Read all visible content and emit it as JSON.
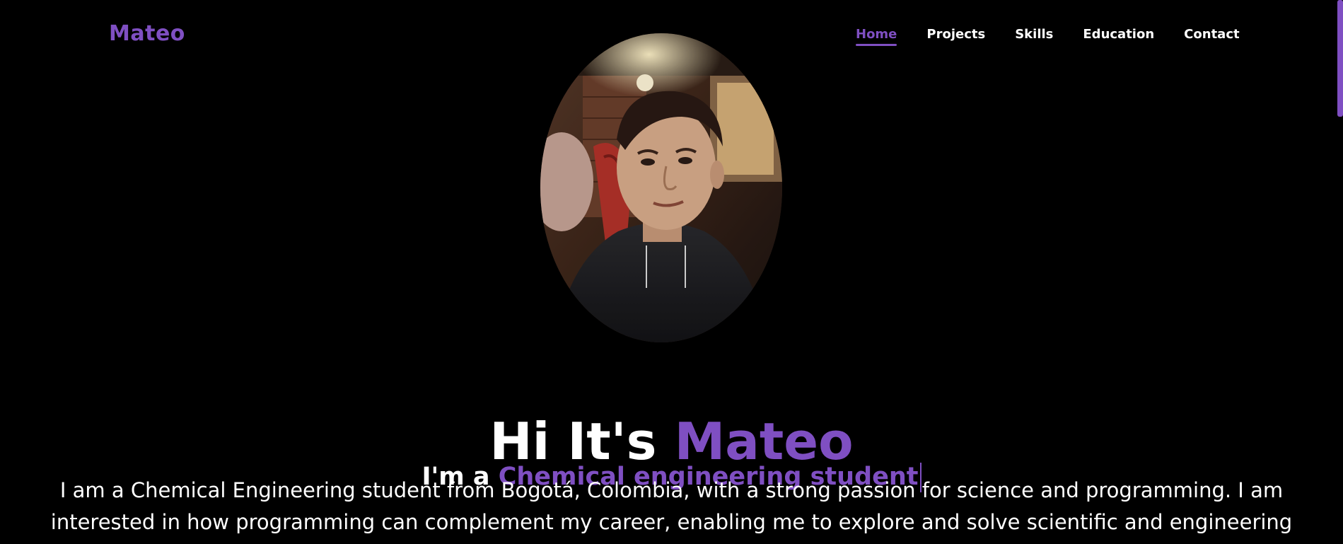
{
  "nav": {
    "logo": "Mateo",
    "links": [
      {
        "label": "Home",
        "active": true
      },
      {
        "label": "Projects",
        "active": false
      },
      {
        "label": "Skills",
        "active": false
      },
      {
        "label": "Education",
        "active": false
      },
      {
        "label": "Contact",
        "active": false
      }
    ]
  },
  "hero": {
    "title_prefix": "Hi It's",
    "title_name": "Mateo",
    "subtitle_prefix": "I'm a",
    "subtitle_role": "Chemical engineering student",
    "description_lines": [
      "I am a Chemical Engineering student from Bogotá, Colombia, with a strong passion for science and programming. I am",
      "interested in how programming can complement my career, enabling me to explore and solve scientific and engineering"
    ]
  },
  "icons": {
    "avatar": "profile-photo"
  },
  "colors": {
    "accent": "#7f4fc2",
    "background": "#000000",
    "text": "#ffffff"
  }
}
